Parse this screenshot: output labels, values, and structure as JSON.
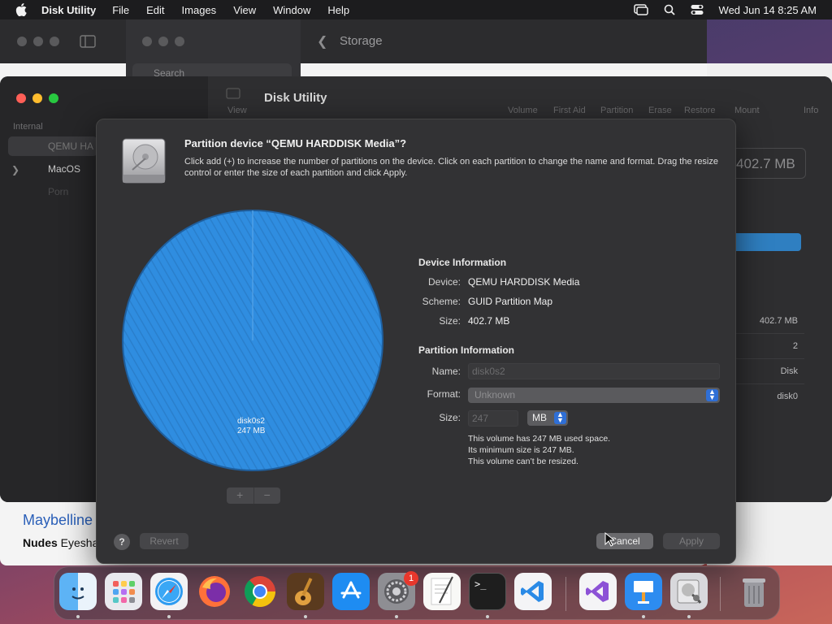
{
  "menubar": {
    "app_name": "Disk Utility",
    "items": [
      "File",
      "Edit",
      "Images",
      "View",
      "Window",
      "Help"
    ],
    "clock": "Wed Jun 14  8:25 AM"
  },
  "background": {
    "safari_search_placeholder": "Search",
    "storage_title": "Storage",
    "web_heading": "Maybelline",
    "web_subtext_bold": "Nudes",
    "web_subtext": " Eyesha"
  },
  "disk_utility": {
    "window_title": "Disk Utility",
    "toolbar_view": "View",
    "toolbar_items": [
      "Volume",
      "First Aid",
      "Partition",
      "Erase",
      "Restore",
      "Mount",
      "Info"
    ],
    "sidebar_section": "Internal",
    "sidebar_items": [
      "QEMU HA",
      "MacOS",
      "Porn"
    ],
    "capacity_display": "402.7 MB",
    "info_values": [
      "402.7 MB",
      "2",
      "Disk",
      "disk0"
    ]
  },
  "sheet": {
    "title": "Partition device “QEMU HARDDISK Media”?",
    "description": "Click add (+) to increase the number of partitions on the device. Click on each partition to change the name and format. Drag the resize control or enter the size of each partition and click Apply.",
    "pie": {
      "label_name": "disk0s2",
      "label_size": "247 MB",
      "used_fraction": 1.0,
      "color": "#2f8de0"
    },
    "add_symbol": "+",
    "remove_symbol": "−",
    "device_info": {
      "heading": "Device Information",
      "device_label": "Device:",
      "device_value": "QEMU HARDDISK Media",
      "scheme_label": "Scheme:",
      "scheme_value": "GUID Partition Map",
      "size_label": "Size:",
      "size_value": "402.7 MB"
    },
    "partition_info": {
      "heading": "Partition Information",
      "name_label": "Name:",
      "name_value": "disk0s2",
      "format_label": "Format:",
      "format_value": "Unknown",
      "size_label": "Size:",
      "size_value": "247",
      "unit_value": "MB"
    },
    "volume_note": [
      "This volume has 247 MB used space.",
      "Its minimum size is 247 MB.",
      "This volume can’t be resized."
    ],
    "help_symbol": "?",
    "revert_label": "Revert",
    "cancel_label": "Cancel",
    "apply_label": "Apply"
  },
  "dock": {
    "apps": [
      "finder-icon",
      "launchpad-icon",
      "safari-icon",
      "firefox-icon",
      "chrome-icon",
      "garageband-icon",
      "app-store-icon",
      "system-settings-icon",
      "textedit-icon",
      "terminal-icon",
      "vscode-icon",
      "visual-studio-icon",
      "keynote-icon",
      "disk-utility-icon",
      "trash-icon"
    ],
    "settings_badge": "1",
    "terminal_glyph": ">_"
  }
}
